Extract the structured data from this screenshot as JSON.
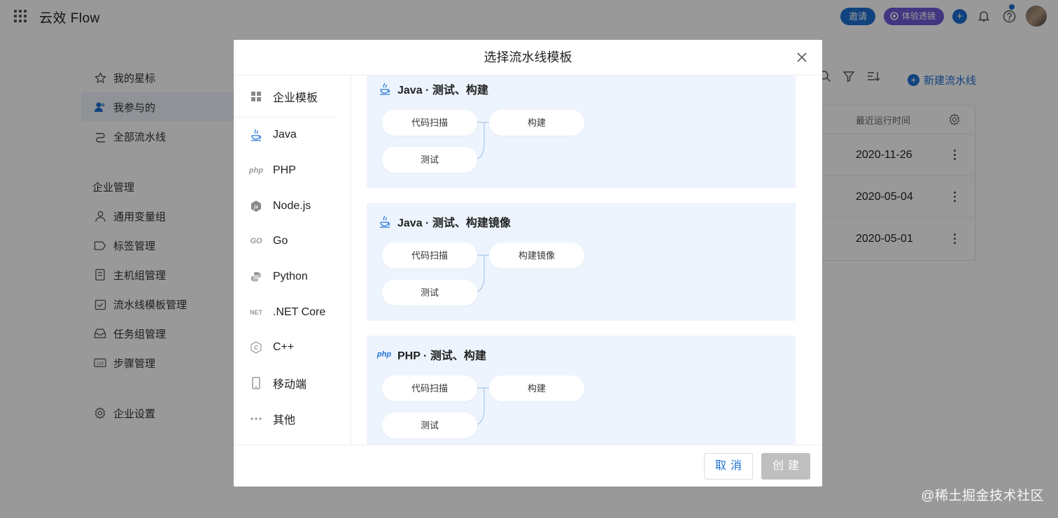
{
  "app": {
    "brand": "云效 Flow"
  },
  "topbar": {
    "invite_label": "邀请",
    "trial_label": "体验透镜"
  },
  "sidebar": {
    "items": [
      {
        "label": "我的星标",
        "icon": "star-icon"
      },
      {
        "label": "我参与的",
        "icon": "user-icon",
        "active": true
      },
      {
        "label": "全部流水线",
        "icon": "pipeline-icon"
      }
    ],
    "section_title": "企业管理",
    "admin_items": [
      {
        "label": "通用变量组",
        "icon": "variables-icon"
      },
      {
        "label": "标签管理",
        "icon": "tag-icon"
      },
      {
        "label": "主机组管理",
        "icon": "host-icon"
      },
      {
        "label": "流水线模板管理",
        "icon": "template-icon"
      },
      {
        "label": "任务组管理",
        "icon": "task-group-icon"
      },
      {
        "label": "步骤管理",
        "icon": "step-icon"
      }
    ],
    "settings_label": "企业设置"
  },
  "main": {
    "new_pipeline_label": "新建流水线",
    "table": {
      "column_last_run": "最近运行时间",
      "rows": [
        {
          "last_run": "2020-11-26"
        },
        {
          "last_run": "2020-05-04"
        },
        {
          "last_run": "2020-05-01"
        }
      ]
    }
  },
  "modal": {
    "title": "选择流水线模板",
    "categories": [
      {
        "label": "企业模板",
        "icon": "grid-icon"
      },
      {
        "label": "Java",
        "icon": "java-icon"
      },
      {
        "label": "PHP",
        "icon": "php-icon",
        "glyph": "php"
      },
      {
        "label": "Node.js",
        "icon": "nodejs-icon"
      },
      {
        "label": "Go",
        "icon": "go-icon",
        "glyph": "GO"
      },
      {
        "label": "Python",
        "icon": "python-icon"
      },
      {
        "label": ".NET Core",
        "icon": "dotnet-icon",
        "glyph": "NET"
      },
      {
        "label": "C++",
        "icon": "cpp-icon"
      },
      {
        "label": "移动端",
        "icon": "mobile-icon"
      },
      {
        "label": "其他",
        "icon": "more-icon"
      }
    ],
    "templates": [
      {
        "title": "Java · 测试、构建",
        "lang": "java",
        "stage1": [
          "代码扫描",
          "测试"
        ],
        "stage2": "构建"
      },
      {
        "title": "Java · 测试、构建镜像",
        "lang": "java",
        "stage1": [
          "代码扫描",
          "测试"
        ],
        "stage2": "构建镜像"
      },
      {
        "title": "PHP · 测试、构建",
        "lang": "php",
        "stage1": [
          "代码扫描",
          "测试"
        ],
        "stage2": "构建"
      }
    ],
    "cancel_label": "取消",
    "create_label": "创建"
  },
  "watermark": "@稀土掘金技术社区",
  "colors": {
    "primary": "#1b6fd2",
    "trial": "#6b5ad8",
    "card_bg": "#eef4fd",
    "disabled": "#bfbfbf"
  }
}
